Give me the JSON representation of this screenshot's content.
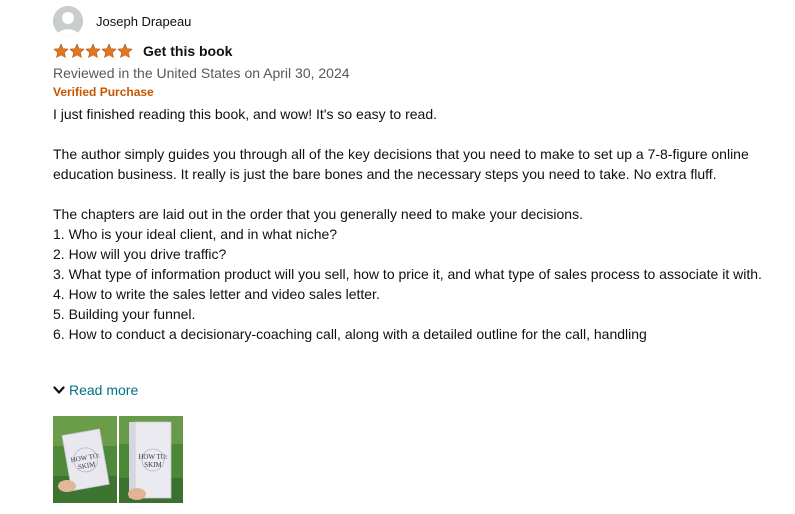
{
  "reviewer": {
    "name": "Joseph Drapeau",
    "avatar_icon": "default-user-avatar-icon"
  },
  "review": {
    "rating": 5,
    "rating_max": 5,
    "star_color": "#de7921",
    "title": "Get this book",
    "date_line": "Reviewed in the United States on April 30, 2024",
    "verified_label": "Verified Purchase",
    "verified_color": "#c45500",
    "paragraphs": [
      "I just finished reading this book, and wow! It's so easy to read.",
      "The author simply guides you through all of the key decisions that you need to make to set up a 7-8-figure online education business. It really is just the bare bones and the necessary steps you need to take. No extra fluff.",
      "The chapters are laid out in the order that you generally need to make your decisions.\n1. Who is your ideal client, and in what niche?\n2. How will you drive traffic?\n3. What type of information product will you sell, how to price it, and what type of sales process to associate it with.\n4. How to write the sales letter and video sales letter.\n5. Building your funnel.\n6. How to conduct a decisionary-coaching call, along with a detailed outline for the call, handling"
    ],
    "read_more_label": "Read more",
    "read_more_icon": "chevron-down-icon",
    "link_color": "#007185"
  },
  "images": [
    {
      "cover_text": "HOW TO: SKIM",
      "alt": "book photo 1"
    },
    {
      "cover_text": "HOW TO: SKIM",
      "alt": "book photo 2"
    }
  ]
}
